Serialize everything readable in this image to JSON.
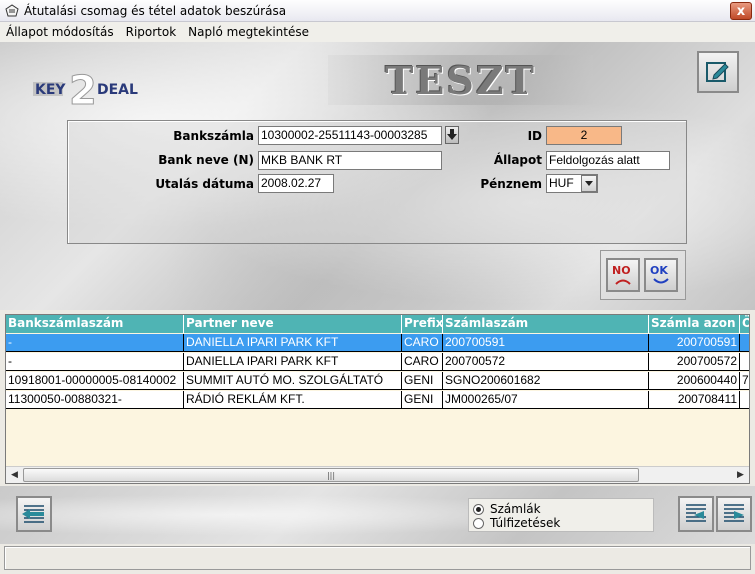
{
  "window": {
    "title": "Átutalási csomag és tétel adatok beszúrása",
    "close_label": "x"
  },
  "menu": [
    {
      "label": "Állapot módosítás"
    },
    {
      "label": "Riportok"
    },
    {
      "label": "Napló megtekintése"
    }
  ],
  "logo": {
    "left": "KEY",
    "middle": "2",
    "right": "DEAL"
  },
  "banner": {
    "text": "TESZT"
  },
  "form": {
    "bankszamla_label": "Bankszámla",
    "bankszamla_value": "10300002-25511143-00003285",
    "bank_neve_label": "Bank neve (N)",
    "bank_neve_value": "MKB BANK RT",
    "utalas_datuma_label": "Utalás dátuma",
    "utalas_datuma_value": "2008.02.27",
    "id_label": "ID",
    "id_value": "2",
    "allapot_label": "Állapot",
    "allapot_value": "Feldolgozás alatt",
    "penznem_label": "Pénznem",
    "penznem_value": "HUF"
  },
  "actions": {
    "no_label": "NO",
    "ok_label": "OK"
  },
  "grid": {
    "columns": [
      "Bankszámlaszám",
      "Partner neve",
      "Prefix",
      "Számlaszám",
      "Számla azon",
      "Ö"
    ],
    "rows": [
      [
        "-",
        "DANIELLA IPARI PARK KFT",
        "CARO",
        "200700591",
        "200700591",
        ""
      ],
      [
        "-",
        "DANIELLA IPARI PARK KFT",
        "CARO",
        "200700572",
        "200700572",
        ""
      ],
      [
        "10918001-00000005-08140002",
        "SUMMIT AUTÓ MO. SZOLGÁLTATÓ",
        "GENI",
        "SGNO200601682",
        "200600440",
        "7"
      ],
      [
        "11300050-00880321-",
        "RÁDIÓ REKLÁM KFT.",
        "GENI",
        "JM000265/07",
        "200708411",
        ""
      ]
    ],
    "selected_row": 0
  },
  "radio": {
    "szamlak_label": "Számlák",
    "tulfizetesek_label": "Túlfizetések",
    "selected": "szamlak"
  },
  "colors": {
    "header_bg": "#4fb4b4",
    "selected_row": "#3c9cf0",
    "id_field": "#f8b888",
    "grid_bg": "#fcf5e0"
  },
  "icons": {
    "edit": "edit-icon",
    "back": "transfer-back-icon",
    "prev": "list-back-icon",
    "next": "list-forward-icon"
  }
}
